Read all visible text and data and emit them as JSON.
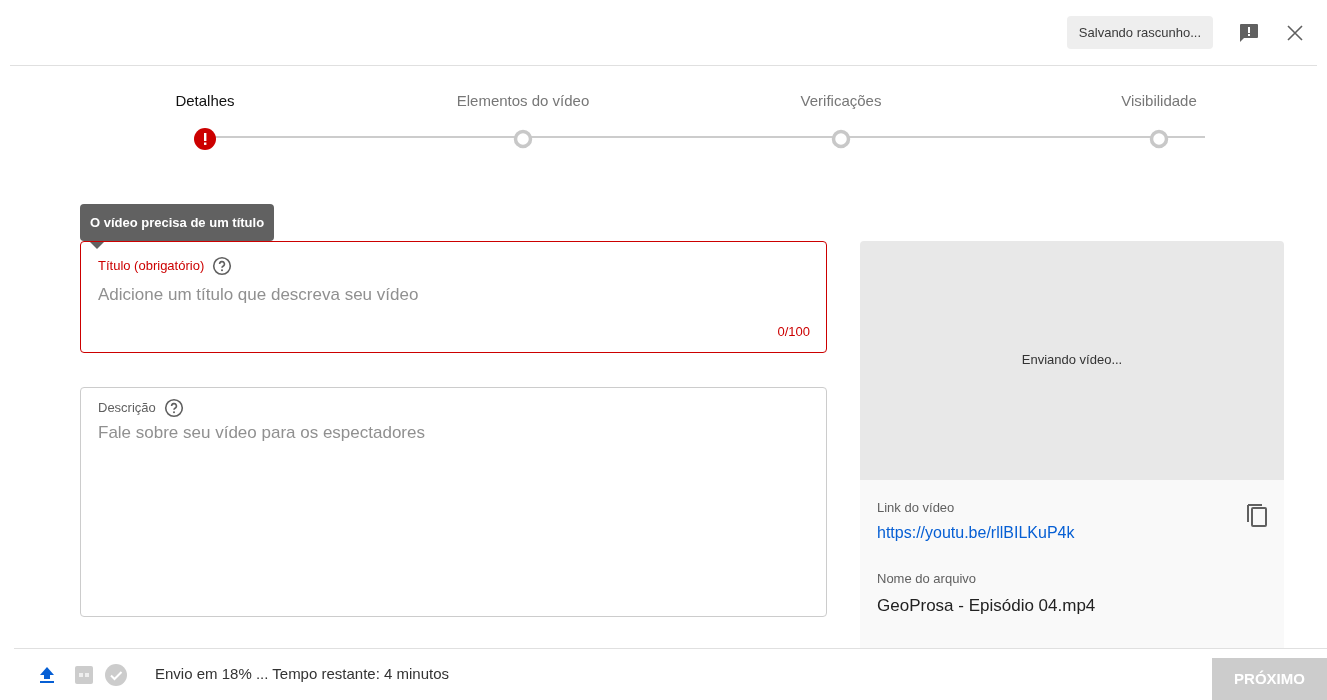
{
  "header": {
    "status_chip": "Salvando rascunho..."
  },
  "steps": [
    {
      "label": "Detalhes",
      "selected": true,
      "error": true
    },
    {
      "label": "Elementos do vídeo",
      "selected": false,
      "error": false
    },
    {
      "label": "Verificações",
      "selected": false,
      "error": false
    },
    {
      "label": "Visibilidade",
      "selected": false,
      "error": false
    }
  ],
  "tooltip": "O vídeo precisa de um título",
  "title_field": {
    "label": "Título (obrigatório)",
    "placeholder": "Adicione um título que descreva seu vídeo",
    "counter": "0/100",
    "error": true
  },
  "description_field": {
    "label": "Descrição",
    "placeholder": "Fale sobre seu vídeo para os espectadores",
    "error": false
  },
  "preview": {
    "status": "Enviando vídeo...",
    "link_label": "Link do vídeo",
    "link": "https://youtu.be/rllBILKuP4k",
    "file_label": "Nome do arquivo",
    "file_name": "GeoProsa - Episódio 04.mp4"
  },
  "footer": {
    "progress_text": "Envio em 18% ... Tempo restante: 4 minutos",
    "next_button": "PRÓXIMO",
    "next_disabled": true
  }
}
